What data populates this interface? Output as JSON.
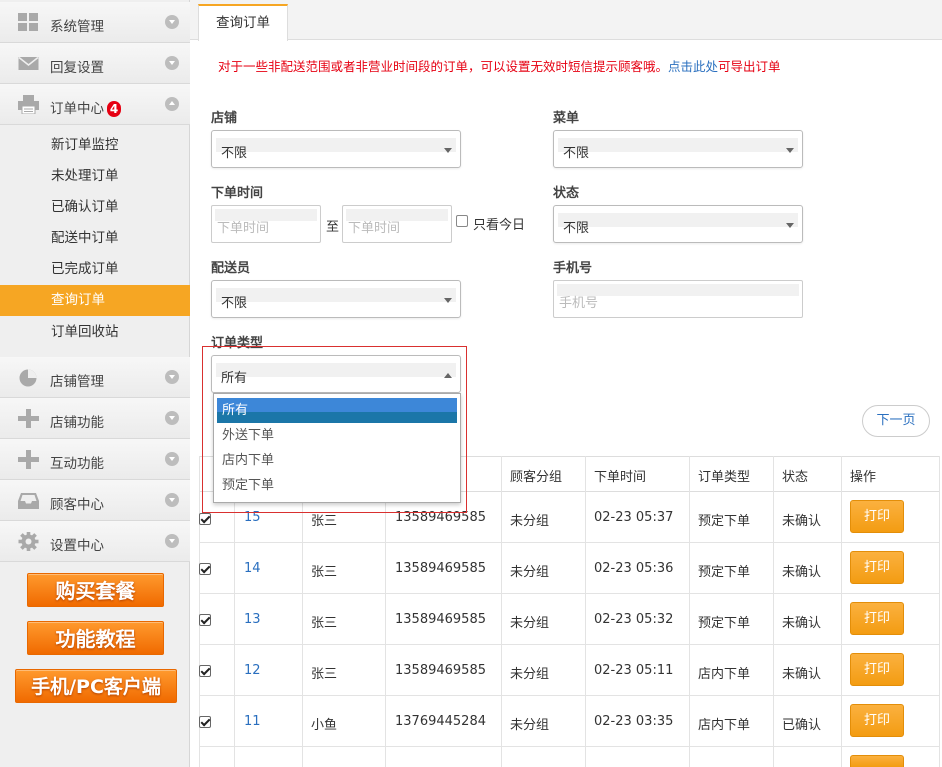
{
  "sidebar": {
    "items": [
      {
        "label": "系统管理",
        "icon": "grid-icon"
      },
      {
        "label": "回复设置",
        "icon": "mail-icon"
      },
      {
        "label": "订单中心",
        "icon": "printer-icon",
        "badge": "4"
      },
      {
        "label": "店铺管理",
        "icon": "pie-chart-icon"
      },
      {
        "label": "店铺功能",
        "icon": "plus-icon"
      },
      {
        "label": "互动功能",
        "icon": "plus-icon"
      },
      {
        "label": "顾客中心",
        "icon": "inbox-icon"
      },
      {
        "label": "设置中心",
        "icon": "gear-icon"
      }
    ],
    "subitems": [
      "新订单监控",
      "未处理订单",
      "已确认订单",
      "配送中订单",
      "已完成订单",
      "查询订单",
      "订单回收站"
    ],
    "active_sub": "查询订单",
    "promo": [
      "购买套餐",
      "功能教程",
      "手机/PC客户端"
    ]
  },
  "tab": {
    "label": "查询订单"
  },
  "notice": {
    "text_before": "对于一些非配送范围或者非营业时间段的订单，可以设置无效时短信提示顾客哦。",
    "link": "点击此处",
    "text_after": "可导出订单"
  },
  "filters": {
    "store_label": "店铺",
    "store_value": "不限",
    "menu_label": "菜单",
    "menu_value": "不限",
    "time_label": "下单时间",
    "time_start_ph": "下单时间",
    "time_sep": "至",
    "time_end_ph": "下单时间",
    "today_only": "只看今日",
    "status_label": "状态",
    "status_value": "不限",
    "courier_label": "配送员",
    "courier_value": "不限",
    "phone_label": "手机号",
    "phone_ph": "手机号",
    "type_label": "订单类型",
    "type_value": "所有",
    "type_options": [
      "所有",
      "外送下单",
      "店内下单",
      "预定下单"
    ]
  },
  "next_page": "下一页",
  "table": {
    "headers": [
      "顾客分组",
      "下单时间",
      "订单类型",
      "状态",
      "操作"
    ],
    "print_label": "打印",
    "rows": [
      {
        "id": "15",
        "name": "张三",
        "phone": "13589469585",
        "group": "未分组",
        "time": "02-23 05:37",
        "type": "预定下单",
        "status": "未确认"
      },
      {
        "id": "14",
        "name": "张三",
        "phone": "13589469585",
        "group": "未分组",
        "time": "02-23 05:36",
        "type": "预定下单",
        "status": "未确认"
      },
      {
        "id": "13",
        "name": "张三",
        "phone": "13589469585",
        "group": "未分组",
        "time": "02-23 05:32",
        "type": "预定下单",
        "status": "未确认"
      },
      {
        "id": "12",
        "name": "张三",
        "phone": "13589469585",
        "group": "未分组",
        "time": "02-23 05:11",
        "type": "店内下单",
        "status": "未确认"
      },
      {
        "id": "11",
        "name": "小鱼",
        "phone": "13769445284",
        "group": "未分组",
        "time": "02-23 03:35",
        "type": "店内下单",
        "status": "已确认"
      }
    ]
  },
  "colors": {
    "accent": "#f6a623",
    "notice": "#e60012",
    "link": "#2a6fbf",
    "badge": "#e60012"
  }
}
